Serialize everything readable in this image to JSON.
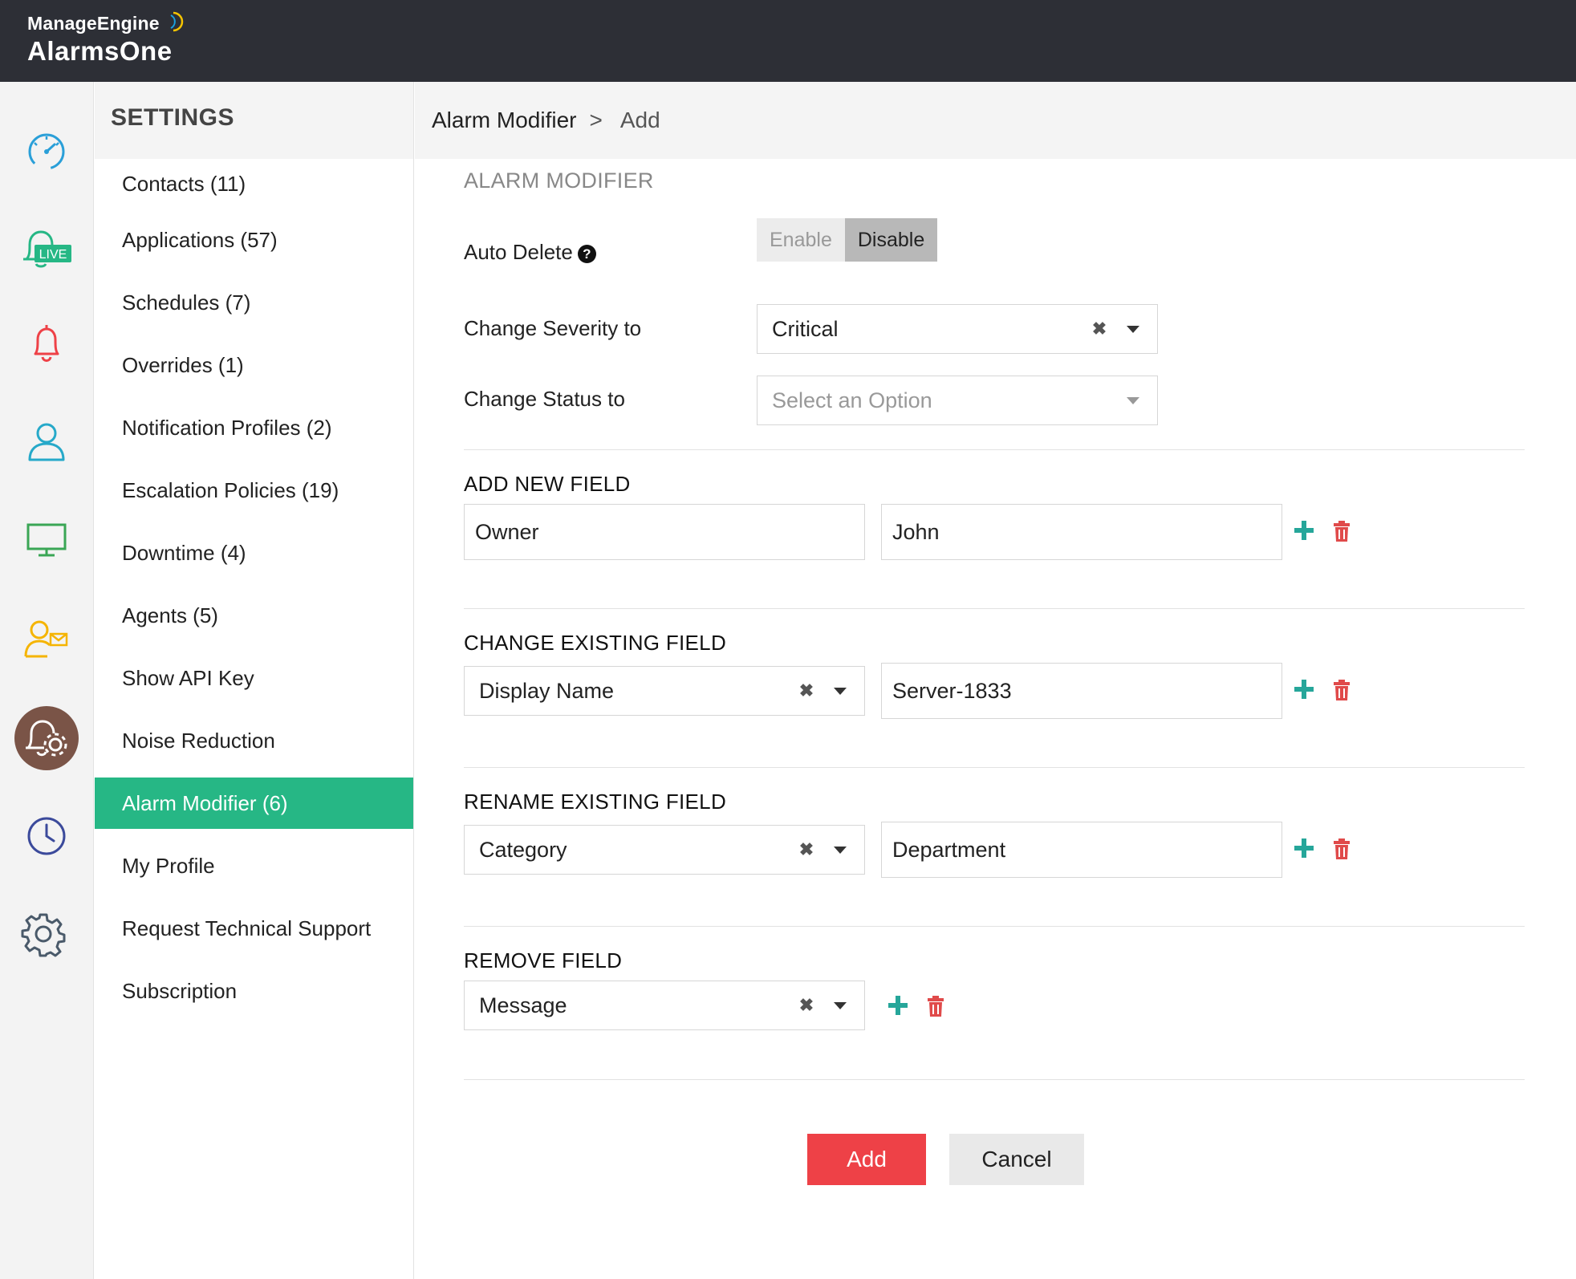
{
  "brand": {
    "vendor": "ManageEngine",
    "product": "AlarmsOne"
  },
  "rail": {
    "items": [
      {
        "icon": "dashboard-gauge-icon",
        "color": "#2a9fd8"
      },
      {
        "icon": "live-bell-icon",
        "badge": "LIVE",
        "color": "#26b785"
      },
      {
        "icon": "alarm-bell-icon",
        "color": "#ee4147"
      },
      {
        "icon": "user-icon",
        "color": "#26a9c9"
      },
      {
        "icon": "monitor-icon",
        "color": "#3aa655"
      },
      {
        "icon": "user-mail-icon",
        "color": "#f5b400"
      },
      {
        "icon": "bell-gear-icon",
        "active": true,
        "color": "#7a5447"
      },
      {
        "icon": "clock-icon",
        "color": "#3b4a9b"
      },
      {
        "icon": "gear-icon",
        "color": "#4a5a6a"
      }
    ]
  },
  "sidebar": {
    "title": "SETTINGS",
    "items": [
      {
        "label": "Contacts (11)"
      },
      {
        "label": "Applications (57)"
      },
      {
        "label": "Schedules (7)"
      },
      {
        "label": "Overrides (1)"
      },
      {
        "label": "Notification Profiles (2)"
      },
      {
        "label": "Escalation Policies (19)"
      },
      {
        "label": "Downtime (4)"
      },
      {
        "label": "Agents (5)"
      },
      {
        "label": "Show API Key"
      },
      {
        "label": "Noise Reduction"
      },
      {
        "label": "Alarm Modifier (6)",
        "active": true
      },
      {
        "label": "My Profile"
      },
      {
        "label": "Request Technical Support"
      },
      {
        "label": "Subscription"
      }
    ]
  },
  "breadcrumb": {
    "parent": "Alarm Modifier",
    "separator": ">",
    "current": "Add"
  },
  "form": {
    "section_title": "ALARM MODIFIER",
    "auto_delete": {
      "label": "Auto Delete",
      "help": "?",
      "options": [
        "Enable",
        "Disable"
      ],
      "selected": "Disable"
    },
    "severity": {
      "label": "Change Severity to",
      "value": "Critical"
    },
    "status": {
      "label": "Change Status to",
      "placeholder": "Select an Option"
    },
    "add_new_field": {
      "heading": "ADD NEW FIELD",
      "key": "Owner",
      "value": "John"
    },
    "change_existing_field": {
      "heading": "CHANGE EXISTING FIELD",
      "field": "Display Name",
      "value": "Server-1833"
    },
    "rename_existing_field": {
      "heading": "RENAME EXISTING FIELD",
      "field": "Category",
      "new_name": "Department"
    },
    "remove_field": {
      "heading": "REMOVE FIELD",
      "field": "Message"
    },
    "clear_glyph": "✖"
  },
  "actions": {
    "add": "Add",
    "cancel": "Cancel"
  },
  "colors": {
    "accent": "#26b785",
    "primary_button": "#ee4147",
    "topbar": "#2d2f36",
    "plus": "#26a69a",
    "trash": "#e04a4a"
  }
}
